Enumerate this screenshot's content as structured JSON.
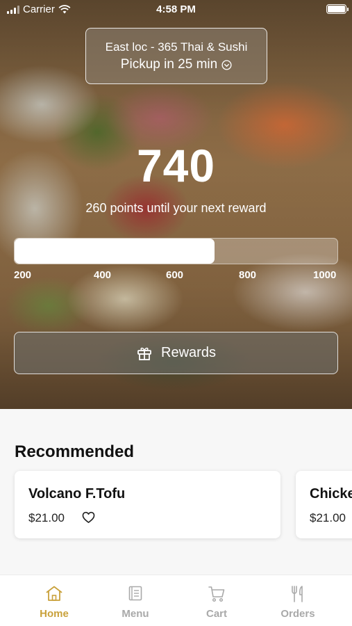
{
  "status_bar": {
    "carrier": "Carrier",
    "time": "4:58 PM"
  },
  "location": {
    "name": "East loc - 365 Thai & Sushi",
    "pickup": "Pickup in 25 min"
  },
  "rewards": {
    "points": "740",
    "message": "260 points until your next reward",
    "progress_fraction": 0.62,
    "ticks": [
      "200",
      "400",
      "600",
      "800",
      "1000"
    ],
    "button_label": "Rewards"
  },
  "recommended": {
    "title": "Recommended",
    "items": [
      {
        "name": "Volcano F.Tofu",
        "price": "$21.00"
      },
      {
        "name": "Chicke",
        "price": "$21.00"
      }
    ]
  },
  "tabs": [
    {
      "label": "Home",
      "icon": "home-icon",
      "active": true
    },
    {
      "label": "Menu",
      "icon": "menu-book-icon",
      "active": false
    },
    {
      "label": "Cart",
      "icon": "cart-icon",
      "active": false
    },
    {
      "label": "Orders",
      "icon": "fork-knife-icon",
      "active": false
    }
  ],
  "colors": {
    "active_tab": "#c9a13b",
    "inactive_tab": "#a9a9a9"
  }
}
